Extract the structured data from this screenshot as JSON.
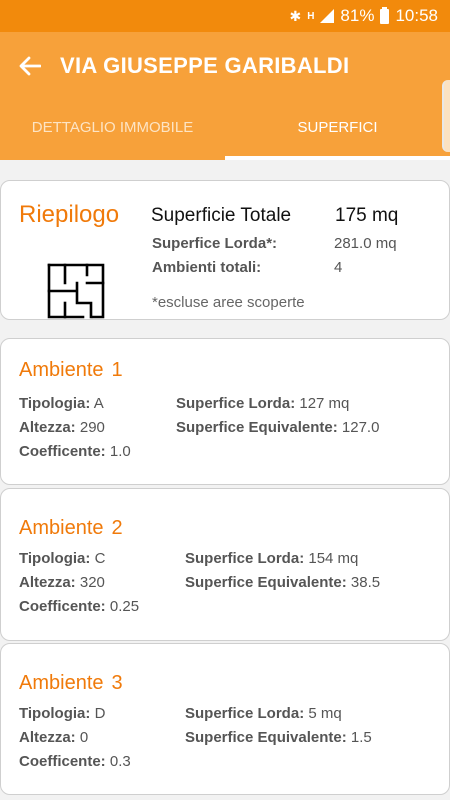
{
  "status": {
    "battery": "81%",
    "time": "10:58"
  },
  "header": {
    "title": "VIA GIUSEPPE GARIBALDI"
  },
  "tabs": [
    {
      "label": "DETTAGLIO IMMOBILE",
      "active": false
    },
    {
      "label": "SUPERFICI",
      "active": true
    }
  ],
  "summary": {
    "heading": "Riepilogo",
    "total_label": "Superficie Totale",
    "total_value": "175 mq",
    "rows": [
      {
        "label": "Superfice Lorda*:",
        "value": "281.0 mq"
      },
      {
        "label": "Ambienti totali:",
        "value": "4"
      }
    ],
    "note": "*escluse aree scoperte"
  },
  "rooms": [
    {
      "title": "Ambiente",
      "number": "1",
      "tipologia_label": "Tipologia:",
      "tipologia": "A",
      "altezza_label": "Altezza:",
      "altezza": "290",
      "coeff_label": "Coefficente:",
      "coeff": "1.0",
      "lorda_label": "Superfice Lorda:",
      "lorda": "127 mq",
      "equiv_label": "Superfice Equivalente:",
      "equiv": "127.0"
    },
    {
      "title": "Ambiente",
      "number": "2",
      "tipologia_label": "Tipologia:",
      "tipologia": "C",
      "altezza_label": "Altezza:",
      "altezza": "320",
      "coeff_label": "Coefficente:",
      "coeff": "0.25",
      "lorda_label": "Superfice Lorda:",
      "lorda": "154 mq",
      "equiv_label": "Superfice Equivalente:",
      "equiv": "38.5"
    },
    {
      "title": "Ambiente",
      "number": "3",
      "tipologia_label": "Tipologia:",
      "tipologia": "D",
      "altezza_label": "Altezza:",
      "altezza": "0",
      "coeff_label": "Coefficente:",
      "coeff": "0.3",
      "lorda_label": "Superfice Lorda:",
      "lorda": "5 mq",
      "equiv_label": "Superfice Equivalente:",
      "equiv": "1.5"
    }
  ],
  "colors": {
    "statusbar": "#f28a0c",
    "appbar": "#f7a13a",
    "accent": "#f07a0a"
  }
}
